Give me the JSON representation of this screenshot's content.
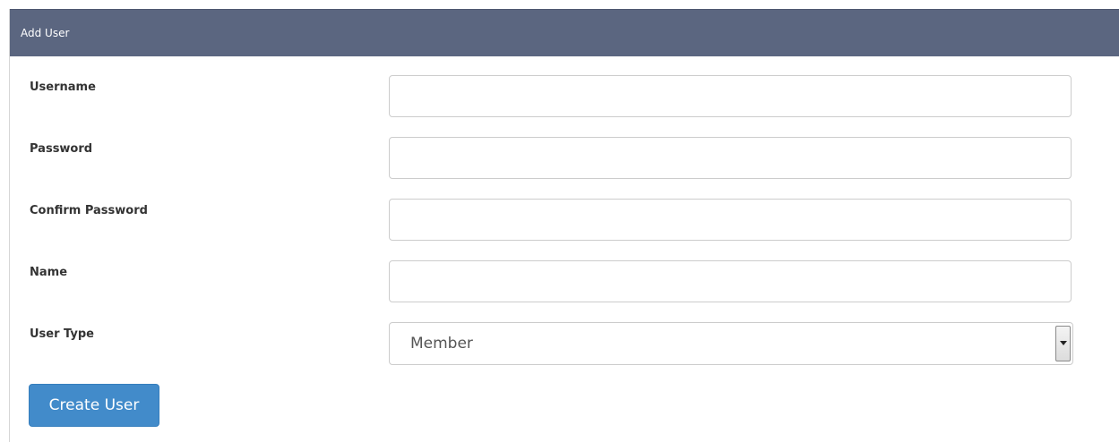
{
  "panel": {
    "title": "Add User"
  },
  "form": {
    "username": {
      "label": "Username",
      "value": "",
      "placeholder": ""
    },
    "password": {
      "label": "Password",
      "value": "",
      "placeholder": ""
    },
    "confirm_password": {
      "label": "Confirm Password",
      "value": "",
      "placeholder": ""
    },
    "name": {
      "label": "Name",
      "value": "",
      "placeholder": ""
    },
    "user_type": {
      "label": "User Type",
      "selected": "Member"
    },
    "submit_label": "Create User"
  },
  "colors": {
    "header_bg": "#5b6680",
    "button_bg": "#428bca"
  }
}
